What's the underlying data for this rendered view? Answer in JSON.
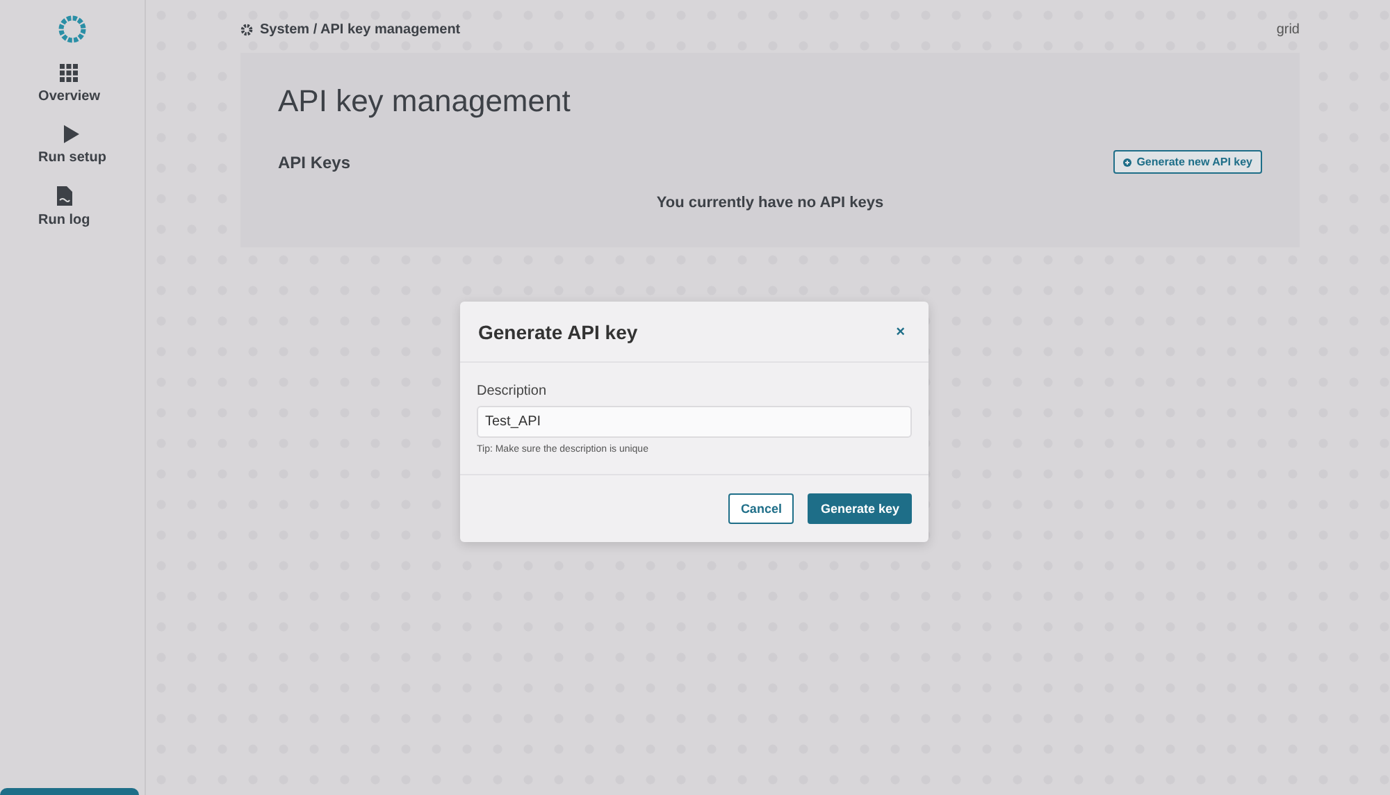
{
  "sidebar": {
    "items": [
      {
        "label": "Overview"
      },
      {
        "label": "Run setup"
      },
      {
        "label": "Run log"
      }
    ]
  },
  "breadcrumb": "System / API key management",
  "user": "grid",
  "page": {
    "title": "API key management",
    "section_title": "API Keys",
    "new_key_button": "Generate new API key",
    "empty_message": "You currently have no API keys"
  },
  "dialog": {
    "title": "Generate API key",
    "close": "×",
    "field_label": "Description",
    "field_value": "Test_API",
    "tip": "Tip: Make sure the description is unique",
    "buttons": [
      {
        "label": "Cancel",
        "kind": "secondary"
      },
      {
        "label": "Generate key",
        "kind": "primary"
      }
    ]
  }
}
